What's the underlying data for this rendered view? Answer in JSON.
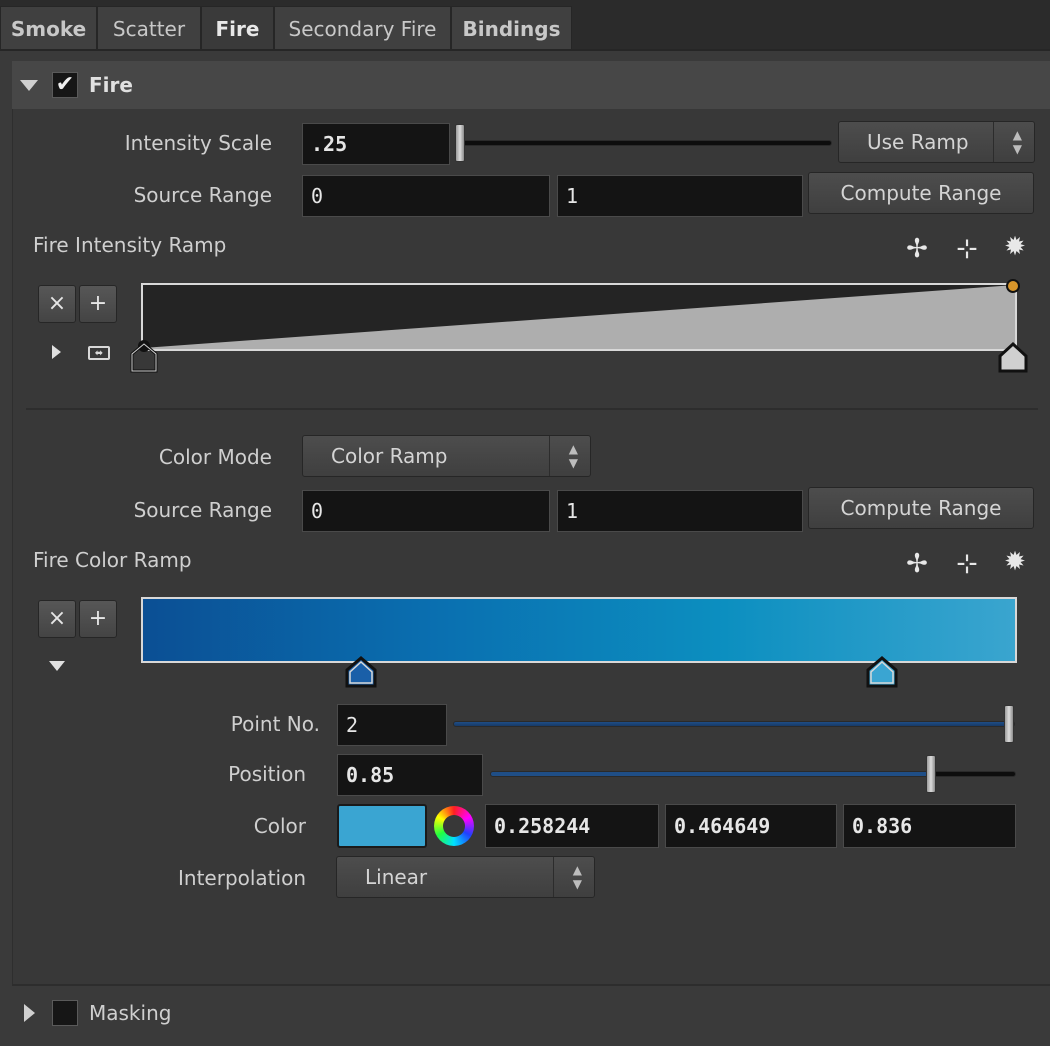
{
  "tabs": [
    {
      "label": "Smoke"
    },
    {
      "label": "Scatter"
    },
    {
      "label": "Fire"
    },
    {
      "label": "Secondary Fire"
    },
    {
      "label": "Bindings"
    }
  ],
  "fire_folder": {
    "title": "Fire",
    "enabled": true,
    "intensity_scale": {
      "label": "Intensity Scale",
      "value": ".25",
      "mode": "Use Ramp",
      "slider_fraction": 0.1
    },
    "source_range_1": {
      "label": "Source Range",
      "min": "0",
      "max": "1",
      "button": "Compute Range"
    },
    "intensity_ramp": {
      "label": "Fire Intensity Ramp",
      "start_value": 0,
      "end_value": 1
    },
    "color_mode": {
      "label": "Color Mode",
      "value": "Color Ramp"
    },
    "source_range_2": {
      "label": "Source Range",
      "min": "0",
      "max": "1",
      "button": "Compute Range"
    },
    "color_ramp": {
      "label": "Fire Color Ramp",
      "colors": [
        "#0b4f94",
        "#0a6fb0",
        "#0c8fc0",
        "#3aa5cf"
      ],
      "keys": [
        0.25,
        0.85
      ]
    },
    "point_no": {
      "label": "Point No.",
      "value": "2",
      "slider_fraction": 1.0
    },
    "position": {
      "label": "Position",
      "value": "0.85",
      "slider_fraction": 0.85
    },
    "color": {
      "label": "Color",
      "swatch": "#3aa5d2",
      "r": "0.258244",
      "g": "0.464649",
      "b": "0.836"
    },
    "interpolation": {
      "label": "Interpolation",
      "value": "Linear"
    }
  },
  "ramp_buttons": {
    "remove": "×",
    "add": "+"
  },
  "icons": {
    "fit": "✢",
    "flip": "⊹",
    "gear": "✹"
  },
  "masking_folder": {
    "title": "Masking",
    "enabled": false
  }
}
